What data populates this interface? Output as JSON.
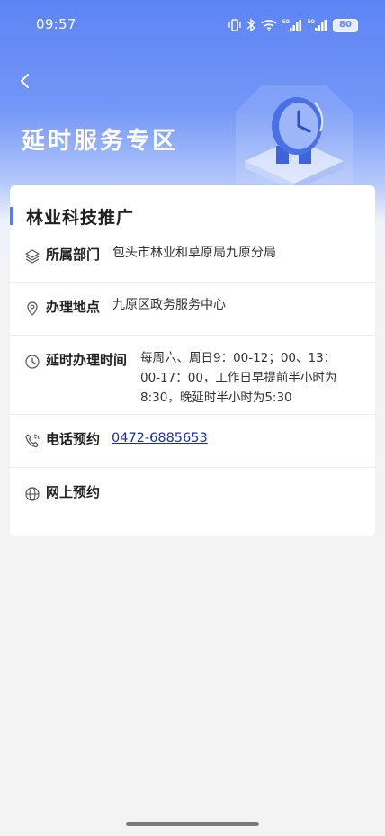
{
  "status_bar": {
    "time": "09:57",
    "network_labels": [
      "5G",
      "5G"
    ],
    "battery": "80"
  },
  "header": {
    "title": "延时服务专区",
    "back_icon": "chevron-left-icon",
    "gradient_top": "#5d84f5",
    "accent": "#4f7ef5"
  },
  "card": {
    "title": "林业科技推广",
    "rows": [
      {
        "icon": "layers-icon",
        "label": "所属部门",
        "value": "包头市林业和草原局九原分局"
      },
      {
        "icon": "location-pin-icon",
        "label": "办理地点",
        "value": "九原区政务服务中心"
      },
      {
        "icon": "clock-icon",
        "label": "延时办理时间",
        "value_lines": [
          "每周六、周日9：00-12；00、13：",
          "00-17：00，工作日早提前半小时为",
          "8:30，晚延时半小时为5:30"
        ]
      },
      {
        "icon": "phone-icon",
        "label": "电话预约",
        "value": "0472-6885653"
      },
      {
        "icon": "globe-icon",
        "label": "网上预约",
        "value": ""
      }
    ]
  }
}
